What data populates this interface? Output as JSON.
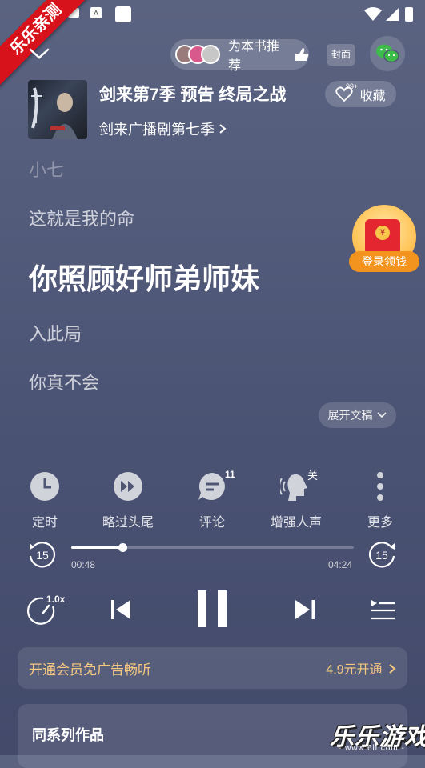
{
  "watermark": {
    "ribbon_text": "乐乐亲测",
    "logo_text": "乐乐游戏",
    "url_text": "- www.6ll.com -"
  },
  "header": {
    "recommend_label": "为本书推荐",
    "cover_label": "封面"
  },
  "book": {
    "title": "剑来第7季 预告 终局之战",
    "series_link": "剑来广播剧第七季",
    "favorite_label": "收藏",
    "favorite_count": "99+"
  },
  "lyrics": {
    "prev_faded": "小七",
    "prev": "这就是我的命",
    "current": "你照顾好师弟师妹",
    "next1": "入此局",
    "next2": "你真不会"
  },
  "red_packet": {
    "label": "登录领钱"
  },
  "expand_label": "展开文稿",
  "tools": {
    "timer": "定时",
    "skip": "略过头尾",
    "comments": "评论",
    "comments_count": "11",
    "voice": "增强人声",
    "voice_state": "关",
    "more": "更多"
  },
  "player": {
    "elapsed": "00:48",
    "total": "04:24",
    "progress": 0.18,
    "rewind_seconds": "15",
    "forward_seconds": "15",
    "speed": "1.0x"
  },
  "vip": {
    "text": "开通会员免广告畅听",
    "price": "4.9元开通"
  },
  "series_section": {
    "heading": "同系列作品"
  }
}
